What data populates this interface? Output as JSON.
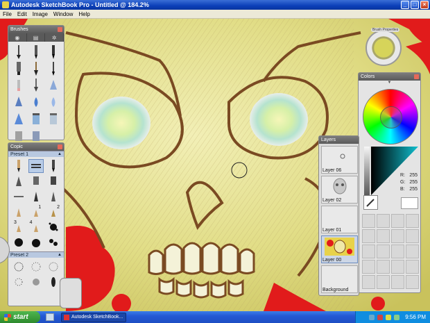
{
  "window": {
    "title": "Autodesk SketchBook Pro - Untitled @ 184.2%"
  },
  "menu": [
    "File",
    "Edit",
    "Image",
    "Window",
    "Help"
  ],
  "brushes_panel": {
    "title": "Brushes"
  },
  "copic_panel": {
    "title": "Copic",
    "preset1": "Preset 1",
    "preset2": "Preset 2",
    "numbers": [
      "1",
      "2",
      "3",
      "4"
    ]
  },
  "puck": {
    "label": "Brush Properties"
  },
  "colors_panel": {
    "title": "Colors",
    "r_label": "R:",
    "r_value": "255",
    "g_label": "G:",
    "g_value": "255",
    "b_label": "B:",
    "b_value": "255"
  },
  "layers_panel": {
    "title": "Layers",
    "layers": [
      {
        "name": "Layer 06"
      },
      {
        "name": "Layer 02"
      },
      {
        "name": "Layer 01"
      },
      {
        "name": "Layer 00"
      },
      {
        "name": "Background"
      }
    ]
  },
  "taskbar": {
    "start": "start",
    "task_label": "Autodesk SketchBook...",
    "clock": "9:56 PM"
  },
  "colors": {
    "accent": "#0b3fb8",
    "canvas_yellow": "#e3e08a",
    "skull_brown": "#7a4a22",
    "paint_red": "#e11b1b"
  }
}
